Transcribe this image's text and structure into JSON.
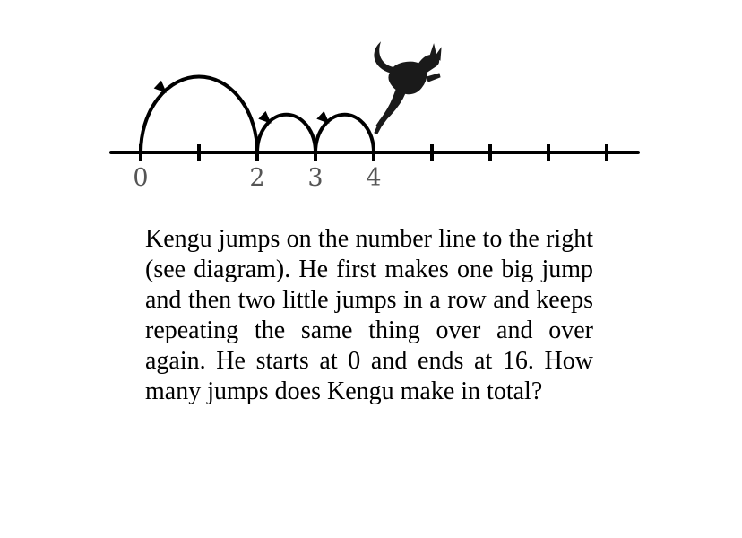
{
  "number_line": {
    "labels": [
      {
        "value": 0,
        "text": "0"
      },
      {
        "value": 2,
        "text": "2"
      },
      {
        "value": 3,
        "text": "3"
      },
      {
        "value": 4,
        "text": "4"
      }
    ],
    "tick_values": [
      0,
      1,
      2,
      3,
      4,
      5,
      6,
      7,
      8
    ],
    "jumps": [
      {
        "from": 0,
        "to": 2
      },
      {
        "from": 2,
        "to": 3
      },
      {
        "from": 3,
        "to": 4
      }
    ]
  },
  "problem": {
    "text": "Kengu jumps on the number line to the right (see diagram). He first makes one big jump and then two little jumps in a row and keeps repeating the same thing over and over again. He starts at 0 and ends at 16. How many jumps does Kengu make in total?"
  },
  "icons": {
    "kangaroo": "kangaroo-icon"
  }
}
